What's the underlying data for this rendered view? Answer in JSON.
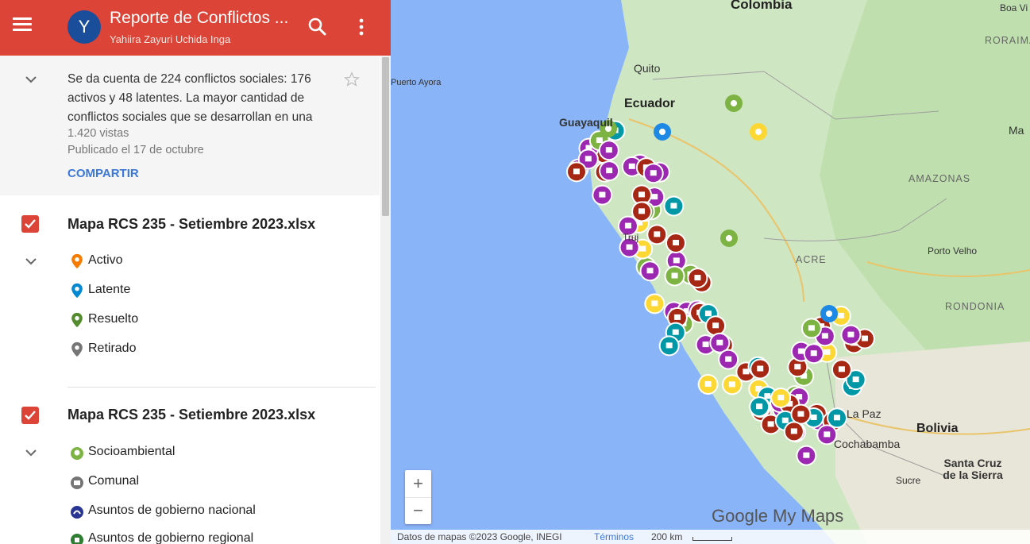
{
  "header": {
    "avatar_letter": "Y",
    "title": "Reporte de Conflictos ...",
    "subtitle": "Yahiira Zayuri Uchida Inga",
    "bg_color": "#db4437"
  },
  "description": {
    "text": "Se da cuenta de 224 conflictos sociales: 176 activos y 48 latentes. La mayor cantidad de conflictos sociales que se desarrollan en una",
    "views": "1.420 vistas",
    "published": "Publicado el 17 de octubre",
    "share_label": "COMPARTIR"
  },
  "layers": [
    {
      "title": "Mapa RCS 235 - Setiembre 2023.xlsx",
      "items": [
        {
          "label": "Activo",
          "icon": "pin-orange",
          "color": "#f57c00"
        },
        {
          "label": "Latente",
          "icon": "pin-blue",
          "color": "#0288d1"
        },
        {
          "label": "Resuelto",
          "icon": "pin-green",
          "color": "#558b2f"
        },
        {
          "label": "Retirado",
          "icon": "pin-gray",
          "color": "#757575"
        }
      ]
    },
    {
      "title": "Mapa RCS 235 - Setiembre 2023.xlsx",
      "items": [
        {
          "label": "Socioambiental",
          "icon": "circle-green",
          "color": "#7cb342"
        },
        {
          "label": "Comunal",
          "icon": "circle-gray",
          "color": "#757575"
        },
        {
          "label": "Asuntos de gobierno nacional",
          "icon": "circle-navy",
          "color": "#283593"
        },
        {
          "label": "Asuntos de gobierno regional",
          "icon": "circle-darkgreen",
          "color": "#2e7d32"
        }
      ]
    }
  ],
  "map": {
    "labels": {
      "colombia": "Colombia",
      "boa_vista": "Boa Vi",
      "roraima": "RORAIMA",
      "quito": "Quito",
      "puerto_ayora": "Puerto Ayora",
      "ecuador": "Ecuador",
      "guayaquil": "Guayaquil",
      "amazonas": "AMAZONAS",
      "acre": "ACRE",
      "porto_velho": "Porto Velho",
      "rondonia": "RONDONIA",
      "la_paz": "La Paz",
      "bolivia": "Bolivia",
      "cochabamba": "Cochabamba",
      "santa_cruz": "Santa Cruz de la Sierra",
      "sucre": "Sucre",
      "ma": "Ma",
      "trujillo": "Truj"
    },
    "zoom_in": "+",
    "zoom_out": "−",
    "logo": "Google My Maps",
    "footer": {
      "data": "Datos de mapas ©2023 Google, INEGI",
      "terms": "Términos",
      "scale": "200 km"
    },
    "colors": {
      "ocean": "#8ab4f8",
      "land": "#cfe6c2",
      "marker_red": "#a52714",
      "marker_purple": "#9c27b0",
      "marker_teal": "#0097a7",
      "marker_yellow": "#fdd835",
      "marker_green": "#7cb342",
      "marker_blue": "#1e88e5"
    }
  }
}
